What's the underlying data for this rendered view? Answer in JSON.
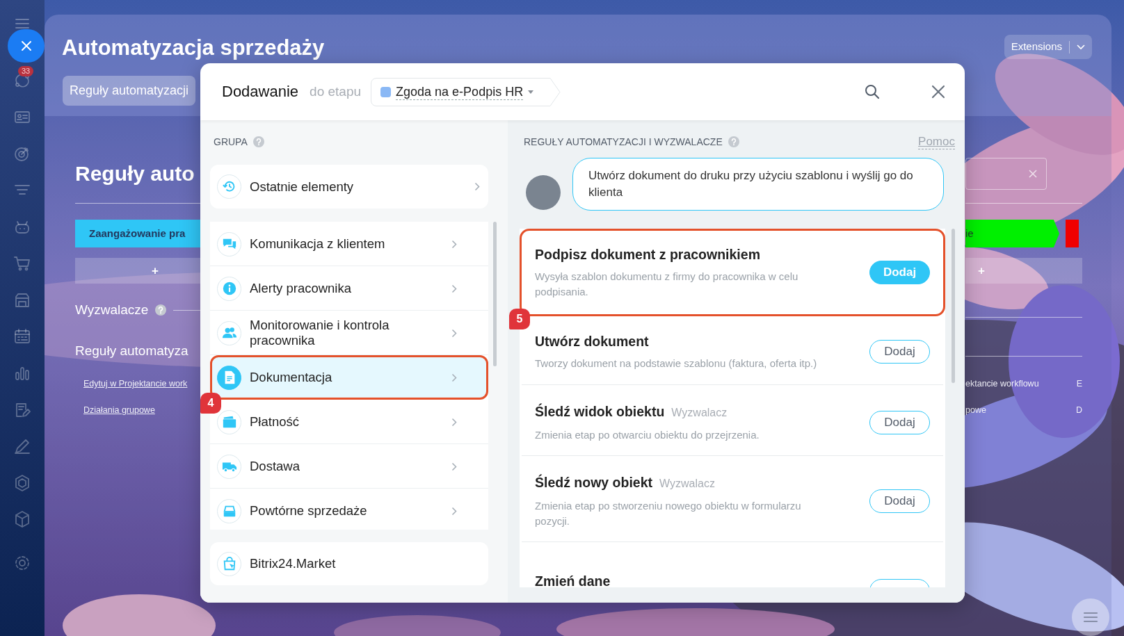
{
  "sidebar": {
    "badge": "33"
  },
  "panel": {
    "title": "Automatyzacja sprzedaży",
    "tabs": [
      {
        "label": "Reguły automatyzacji",
        "selected": true
      }
    ],
    "extensions_button": "Extensions",
    "heading": "Reguły auto",
    "stage_bar": "Zaangażowanie pra",
    "add_button": "+",
    "sections": [
      {
        "label": "Wyzwalacze",
        "help": true
      },
      {
        "label": "Reguły automatyza",
        "help": false
      }
    ],
    "links": [
      "Edytuj w Projektancie work",
      "Działania grupowe"
    ],
    "right_stage_bar": "ie",
    "right_add_button": "+",
    "right_links": [
      {
        "text": "ektancie workflowu",
        "letter": "E"
      },
      {
        "text": "powe",
        "letter": "D"
      }
    ]
  },
  "modal": {
    "title": "Dodawanie",
    "subtitle": "do etapu",
    "stage": {
      "label": "Zgoda na e-Podpis HR",
      "color": "#8ab8f5"
    },
    "groups_header": "GRUPA",
    "recent": {
      "label": "Ostatnie elementy",
      "kind": "history"
    },
    "groups": [
      {
        "label": "Komunikacja z klientem",
        "kind": "chat",
        "selected": false,
        "highlighted": false
      },
      {
        "label": "Alerty pracownika",
        "kind": "info",
        "selected": false,
        "highlighted": false
      },
      {
        "label": "Monitorowanie i kontrola pracownika",
        "kind": "people",
        "selected": false,
        "highlighted": false
      },
      {
        "label": "Dokumentacja",
        "kind": "document",
        "selected": true,
        "highlighted": true,
        "callout": "4"
      },
      {
        "label": "Płatność",
        "kind": "wallet",
        "selected": false,
        "highlighted": false
      },
      {
        "label": "Dostawa",
        "kind": "truck",
        "selected": false,
        "highlighted": false
      },
      {
        "label": "Powtórne sprzedaże",
        "kind": "register",
        "selected": false,
        "highlighted": false
      }
    ],
    "market": {
      "label": "Bitrix24.Market",
      "kind": "market"
    },
    "rules_header": "REGUŁY AUTOMATYZACJI I WYZWALACZE",
    "help_link": "Pomoc",
    "hint": "Utwórz dokument do druku przy użyciu szablonu i wyślij go do klienta",
    "rules": [
      {
        "title": "Podpisz dokument z pracownikiem",
        "description": "Wysyła szablon dokumentu z firmy do pracownika w celu podpisania.",
        "button": "Dodaj",
        "highlighted": true,
        "callout": "5"
      },
      {
        "title": "Utwórz dokument",
        "description": "Tworzy dokument na podstawie szablonu (faktura, oferta itp.)",
        "button": "Dodaj",
        "highlighted": false
      },
      {
        "title": "Śledź widok obiektu",
        "tag": "Wyzwalacz",
        "description": "Zmienia etap po otwarciu obiektu do przejrzenia.",
        "button": "Dodaj",
        "highlighted": false
      },
      {
        "title": "Śledź nowy obiekt",
        "tag": "Wyzwalacz",
        "description": "Zmienia etap po stworzeniu nowego obiektu w formularzu pozycji.",
        "button": "Dodaj",
        "highlighted": false
      },
      {
        "title": "Zmień dane",
        "highlighted": false
      }
    ]
  }
}
